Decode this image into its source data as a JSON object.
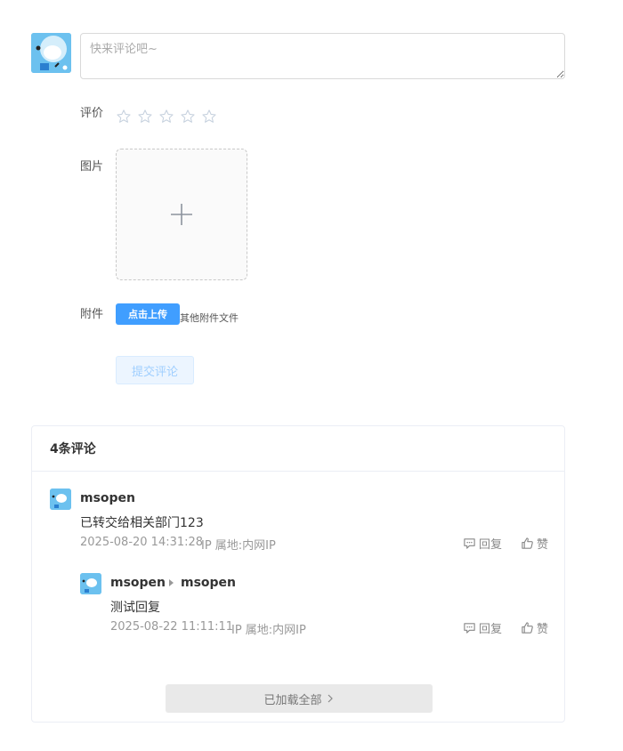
{
  "composer": {
    "placeholder": "快来评论吧~",
    "rating_label": "评价",
    "rating": 0,
    "max_rating": 5,
    "image_label": "图片",
    "attachment_label": "附件",
    "upload_button": "点击上传",
    "upload_hint": "其他附件文件",
    "submit_button": "提交评论"
  },
  "comments": {
    "header": "4条评论",
    "items": [
      {
        "author": "msopen",
        "text": "已转交给相关部门123",
        "time": "2025-08-20 14:31:28",
        "ip": "IP 属地:内网IP",
        "reply_label": "回复",
        "like_label": "赞"
      },
      {
        "author": "msopen",
        "reply_to": "msopen",
        "text": "测试回复",
        "time": "2025-08-22 11:11:11",
        "ip": "IP 属地:内网IP",
        "reply_label": "回复",
        "like_label": "赞"
      }
    ],
    "load_all": "已加载全部"
  },
  "colors": {
    "primary": "#409eff",
    "avatar_bg": "#6cc1ef",
    "muted_text": "#999999",
    "disabled_button_bg": "#ecf5ff"
  },
  "icons": {
    "star": "star-outline-icon",
    "plus": "plus-icon",
    "reply": "comment-bubble-icon",
    "like": "thumbs-up-icon",
    "chevron": "chevron-right-icon",
    "reply_arrow": "caret-right-icon"
  }
}
